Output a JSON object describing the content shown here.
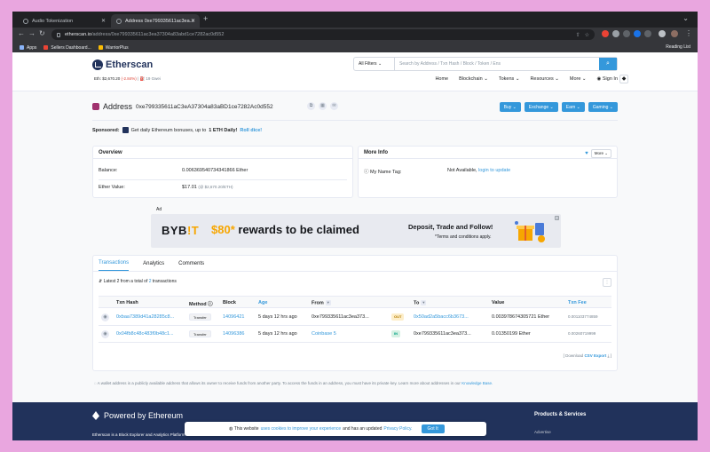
{
  "browser": {
    "tabs": [
      {
        "title": "Audio Tokenization",
        "active": false
      },
      {
        "title": "Address 0xe799335611ac3ea...",
        "active": true
      }
    ],
    "url_host": "etherscan.io",
    "url_path": "/address/0xe799335611ac3ea37304a83abd1ce7282ac0d552",
    "bookmarks": [
      "Apps",
      "Sellers Dashboard...",
      "WarriorPlus"
    ],
    "reading_list": "Reading List"
  },
  "header": {
    "brand": "Etherscan",
    "eth_price_label": "Eth: $2,670.20",
    "eth_change": "(-2.84%)",
    "gas": "| ⛽ 19 Gwei",
    "filter_label": "All Filters",
    "search_placeholder": "Search by Address / Txn Hash / Block / Token / Ens",
    "nav": [
      "Home",
      "Blockchain",
      "Tokens",
      "Resources",
      "More",
      "Sign In"
    ]
  },
  "address": {
    "label": "Address",
    "hash": "0xe799335611aC3eA37304a83aBD1ce7282Ac0d552",
    "actions": [
      "Buy",
      "Exchange",
      "Earn",
      "Gaming"
    ]
  },
  "sponsored": {
    "label": "Sponsored:",
    "text": "Get daily Ethereum bonuses, up to",
    "bold": "1 ETH Daily!",
    "link": "Roll dice!"
  },
  "overview": {
    "title": "Overview",
    "balance_label": "Balance:",
    "balance_value": "0.006369540734341866 Ether",
    "ether_value_label": "Ether Value:",
    "ether_value": "$17.01",
    "ether_value_small": "(@ $2,670.20/ETH)"
  },
  "more_info": {
    "title": "More Info",
    "more_btn": "More",
    "name_tag_label": "My Name Tag:",
    "name_tag_value": "Not Available,",
    "name_tag_link": "login to update"
  },
  "ad": {
    "tag": "Ad",
    "brand_a": "BYB",
    "brand_b": "!T",
    "amount": "$80*",
    "headline": " rewards to be claimed",
    "right_title": "Deposit, Trade and Follow!",
    "right_note": "*Terms and conditions apply."
  },
  "transactions": {
    "tabs": [
      "Transactions",
      "Analytics",
      "Comments"
    ],
    "summary_prefix": "Latest 2 from a total of",
    "summary_link": "2",
    "summary_suffix": "transactions",
    "columns": [
      "Txn Hash",
      "Method",
      "Block",
      "Age",
      "From",
      "To",
      "Value",
      "Txn Fee"
    ],
    "rows": [
      {
        "hash": "0xbaa7389d41a28285c8...",
        "method": "Transfer",
        "block": "14096421",
        "age": "5 days 12 hrs ago",
        "from": "0xe799335611ac3ea373...",
        "dir": "OUT",
        "to": "0x50ad2a5bacc6b3673...",
        "value": "0.003978674305721 Ether",
        "fee": "0.001103774859"
      },
      {
        "hash": "0x04fb8c48c483f0b48c1...",
        "method": "Transfer",
        "block": "14096386",
        "age": "5 days 12 hrs ago",
        "from": "Coinbase 5",
        "dir": "IN",
        "to": "0xe799335611ac3ea373...",
        "value": "0.01350199 Ether",
        "fee": "0.00260719999"
      }
    ],
    "download_prefix": "[ Download",
    "download_link": "CSV Export",
    "download_suffix": "]"
  },
  "note": {
    "text": "A wallet address is a publicly available address that allows its owner to receive funds from another party. To access the funds in an address, you must have its private key. Learn more about addresses in our",
    "link": "Knowledge Base."
  },
  "footer": {
    "brand": "Powered by Ethereum",
    "desc": "Etherscan is a Block Explorer and Analytics Platform for",
    "col_title": "Products & Services",
    "col_link": "Advertise"
  },
  "cookie": {
    "text_a": "This website",
    "link_a": "uses cookies to improve your experience",
    "text_b": "and has an updated",
    "link_b": "Privacy Policy.",
    "ok": "Got It"
  },
  "colors": {
    "accent": "#3498db",
    "navy": "#21325b",
    "ad_orange": "#f7a600"
  }
}
